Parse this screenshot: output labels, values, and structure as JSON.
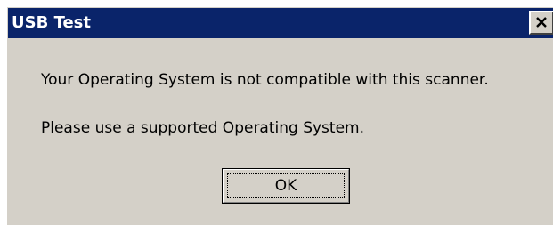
{
  "window": {
    "title": "USB Test",
    "close_icon": "close-icon"
  },
  "message": {
    "line1": "Your Operating System is not compatible with this scanner.",
    "line2": "Please use a supported Operating System."
  },
  "buttons": {
    "ok_label": "OK"
  },
  "colors": {
    "titlebar": "#0a246a",
    "dialog_face": "#d4d0c8",
    "title_text": "#ffffff"
  }
}
